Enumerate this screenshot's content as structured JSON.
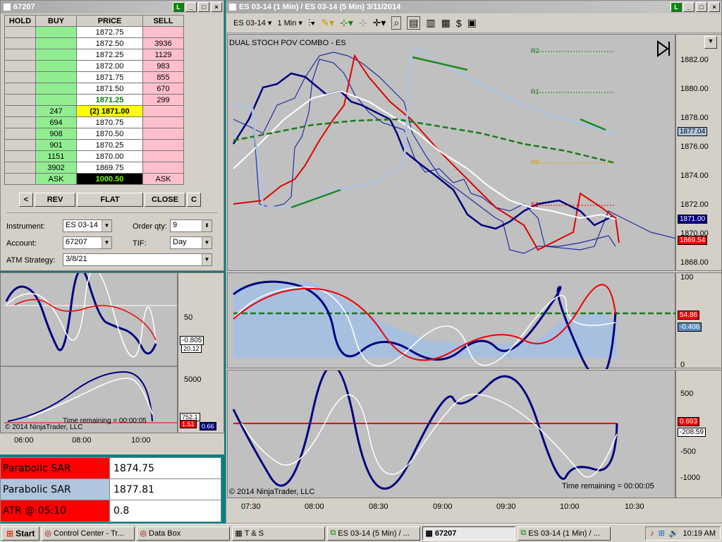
{
  "dom": {
    "title": "67207",
    "headers": {
      "hold": "HOLD",
      "buy": "BUY",
      "price": "PRICE",
      "sell": "SELL"
    },
    "rows": [
      {
        "buy": "",
        "price": "1872.75",
        "sell": "",
        "style": ""
      },
      {
        "buy": "",
        "price": "1872.50",
        "sell": "3936",
        "style": ""
      },
      {
        "buy": "",
        "price": "1872.25",
        "sell": "1129",
        "style": ""
      },
      {
        "buy": "",
        "price": "1872.00",
        "sell": "983",
        "style": ""
      },
      {
        "buy": "",
        "price": "1871.75",
        "sell": "855",
        "style": ""
      },
      {
        "buy": "",
        "price": "1871.50",
        "sell": "670",
        "style": ""
      },
      {
        "buy": "",
        "price": "1871.25",
        "sell": "299",
        "style": "green"
      },
      {
        "buy": "247",
        "price": "(2) 1871.00",
        "sell": "",
        "style": "inside"
      },
      {
        "buy": "694",
        "price": "1870.75",
        "sell": "",
        "style": ""
      },
      {
        "buy": "908",
        "price": "1870.50",
        "sell": "",
        "style": ""
      },
      {
        "buy": "901",
        "price": "1870.25",
        "sell": "",
        "style": ""
      },
      {
        "buy": "1151",
        "price": "1870.00",
        "sell": "",
        "style": ""
      },
      {
        "buy": "3902",
        "price": "1869.75",
        "sell": "",
        "style": ""
      },
      {
        "buy": "ASK",
        "price": "1000.50",
        "sell": "ASK",
        "style": "last"
      }
    ],
    "buttons": {
      "left": "<",
      "rev": "REV",
      "flat": "FLAT",
      "close": "CLOSE",
      "right": "C"
    },
    "form": {
      "instrument_label": "Instrument:",
      "instrument": "ES 03-14",
      "qty_label": "Order qty:",
      "qty": "9",
      "account_label": "Account:",
      "account": "67207",
      "tif_label": "TIF:",
      "tif": "Day",
      "atm_label": "ATM Strategy:",
      "atm": "3/8/21"
    }
  },
  "left_chart": {
    "osc_tick": "50",
    "osc_labels": [
      "-0.805",
      "20.12"
    ],
    "vol_tick": "5000",
    "vol_labels": [
      "752.1",
      "1.51",
      "0.66"
    ],
    "time_remaining": "Time remaining = 00:00:05",
    "copyright": "© 2014 NinjaTrader, LLC",
    "x_ticks": [
      "06:00",
      "08:00",
      "10:00"
    ]
  },
  "databox": [
    {
      "label": "Parabolic SAR",
      "value": "1874.75",
      "color": "#ff0000"
    },
    {
      "label": "Parabolic SAR",
      "value": "1877.81",
      "color": "#b0c4de"
    },
    {
      "label": "ATR @ 05:10",
      "value": "0.8",
      "color": "#ff0000"
    }
  ],
  "chart": {
    "title": "ES 03-14 (1 Min) / ES 03-14 (5 Min)  3/11/2014",
    "toolbar_instrument": "ES 03-14",
    "toolbar_period": "1 Min",
    "indicator_label": "DUAL STOCH POV COMBO - ES",
    "price_ticks": [
      "1882.00",
      "1880.00",
      "1878.00",
      "1876.00",
      "1874.00",
      "1872.00",
      "1870.00",
      "1868.00"
    ],
    "price_tags": [
      {
        "text": "1877.04",
        "color": "#b0c4de"
      },
      {
        "text": "1871.00",
        "color": "#000080"
      },
      {
        "text": "1869.54",
        "color": "#ff0000"
      }
    ],
    "levels": {
      "r2": "R2",
      "r1": "R1",
      "pp": "PP",
      "s1": "S1"
    },
    "stoch_ticks": [
      "100",
      "0"
    ],
    "stoch_tags": [
      "54.86",
      "-0.406"
    ],
    "pov_ticks": [
      "500",
      "-500",
      "-1000"
    ],
    "pov_tags": [
      "0.693",
      "-208.59"
    ],
    "time_remaining": "Time remaining = 00:00:05",
    "copyright": "© 2014 NinjaTrader, LLC",
    "x_ticks": [
      "07:30",
      "08:00",
      "08:30",
      "09:00",
      "09:30",
      "10:00",
      "10:30"
    ]
  },
  "taskbar": {
    "start": "Start",
    "tasks": [
      "Control Center - Tr...",
      "Data Box",
      "T & S",
      "ES 03-14 (5 Min) / ...",
      "67207",
      "ES 03-14 (1 Min) / ..."
    ],
    "clock": "10:19 AM"
  }
}
